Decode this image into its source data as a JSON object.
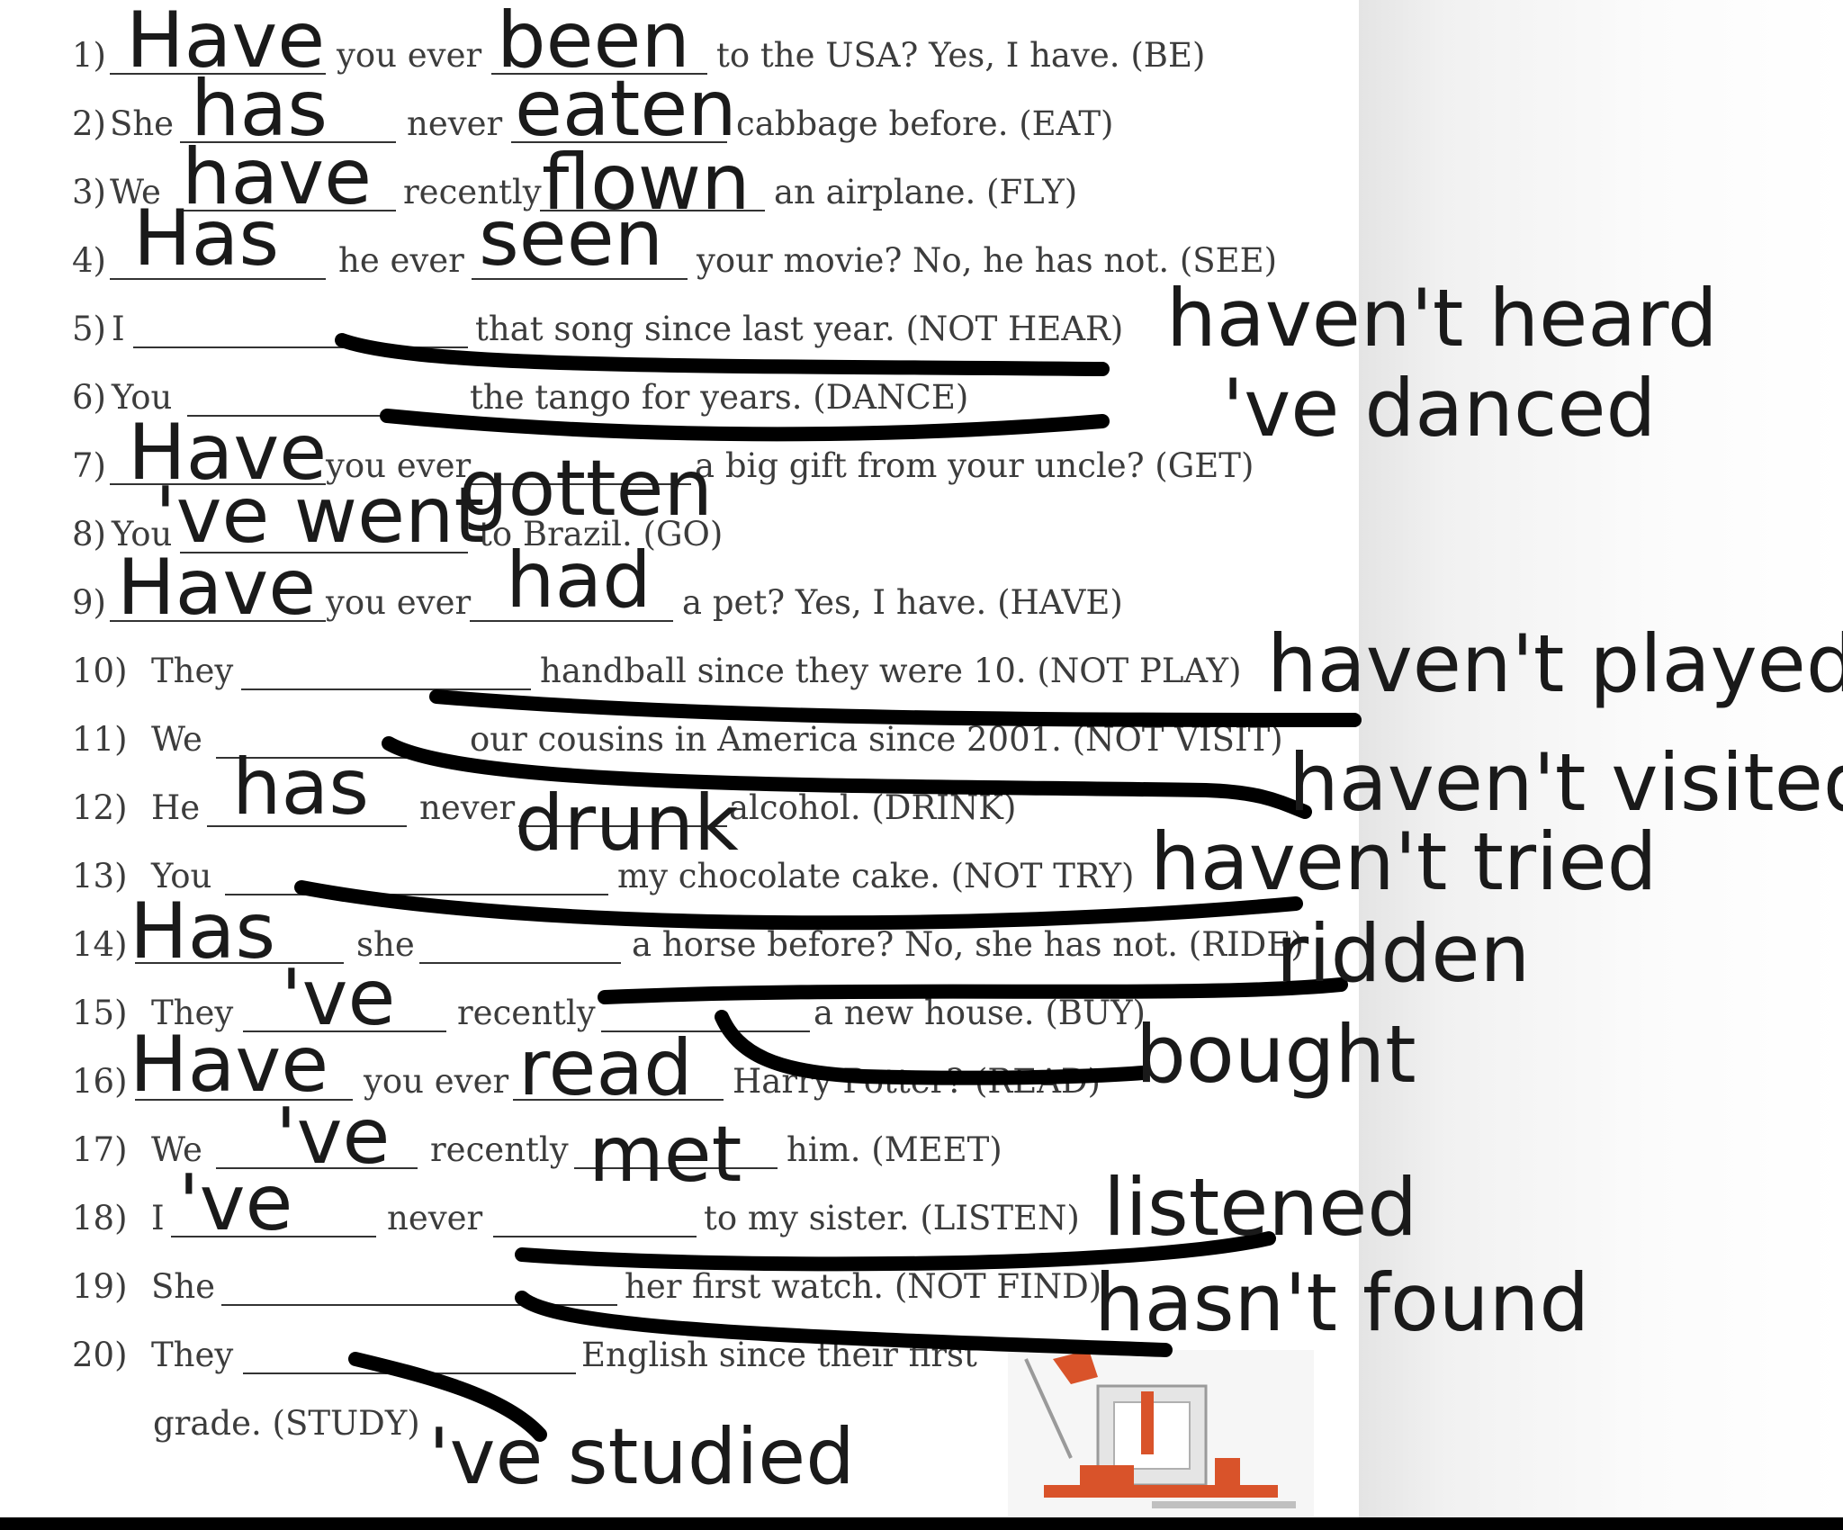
{
  "worksheet": {
    "lines": [
      {
        "n": "1)",
        "texts": [
          "you ever",
          "to the USA? Yes, I have. (BE)"
        ],
        "answers": [
          "Have",
          "been"
        ]
      },
      {
        "n": "2)",
        "texts": [
          "She",
          "never",
          "cabbage before. (EAT)"
        ],
        "answers": [
          "has",
          "eaten"
        ]
      },
      {
        "n": "3)",
        "texts": [
          "We",
          "recently",
          "an airplane. (FLY)"
        ],
        "answers": [
          "have",
          "flown"
        ]
      },
      {
        "n": "4)",
        "texts": [
          "he ever",
          "your movie? No, he has not. (SEE)"
        ],
        "answers": [
          "Has",
          "seen"
        ]
      },
      {
        "n": "5)",
        "texts": [
          "I",
          "that song since last year. (NOT HEAR)"
        ],
        "answers": [
          "haven't heard"
        ]
      },
      {
        "n": "6)",
        "texts": [
          "You",
          "the tango for years. (DANCE)"
        ],
        "answers": [
          "'ve danced"
        ]
      },
      {
        "n": "7)",
        "texts": [
          "you ever",
          "a big gift from your uncle? (GET)"
        ],
        "answers": [
          "Have",
          "gotten"
        ]
      },
      {
        "n": "8)",
        "texts": [
          "You",
          "to Brazil. (GO)"
        ],
        "answers": [
          "'ve went"
        ]
      },
      {
        "n": "9)",
        "texts": [
          "you ever",
          "a pet? Yes, I have. (HAVE)"
        ],
        "answers": [
          "Have",
          "had"
        ]
      },
      {
        "n": "10)",
        "texts": [
          "They",
          "handball since they were 10. (NOT PLAY)"
        ],
        "answers": [
          "haven't played"
        ]
      },
      {
        "n": "11)",
        "texts": [
          "We",
          "our cousins in America since 2001. (NOT VISIT)"
        ],
        "answers": [
          "haven't visited"
        ]
      },
      {
        "n": "12)",
        "texts": [
          "He",
          "never",
          "alcohol. (DRINK)"
        ],
        "answers": [
          "has",
          "drunk"
        ]
      },
      {
        "n": "13)",
        "texts": [
          "You",
          "my chocolate cake. (NOT TRY)"
        ],
        "answers": [
          "haven't tried"
        ]
      },
      {
        "n": "14)",
        "texts": [
          "she",
          "a horse before? No, she has not. (RIDE)"
        ],
        "answers": [
          "Has",
          "ridden"
        ]
      },
      {
        "n": "15)",
        "texts": [
          "They",
          "recently",
          "a new house. (BUY)"
        ],
        "answers": [
          "'ve",
          "bought"
        ]
      },
      {
        "n": "16)",
        "texts": [
          "you ever",
          "Harry Potter? (READ)"
        ],
        "answers": [
          "Have",
          "read"
        ]
      },
      {
        "n": "17)",
        "texts": [
          "We",
          "recently",
          "him. (MEET)"
        ],
        "answers": [
          "'ve",
          "met"
        ]
      },
      {
        "n": "18)",
        "texts": [
          "I",
          "never",
          "to my sister. (LISTEN)"
        ],
        "answers": [
          "'ve",
          "listened"
        ]
      },
      {
        "n": "19)",
        "texts": [
          "She",
          "her first watch. (NOT FIND)"
        ],
        "answers": [
          "hasn't found"
        ]
      },
      {
        "n": "20)",
        "texts": [
          "They",
          "English since their first",
          "grade. (STUDY)"
        ],
        "answers": [
          "'ve studied"
        ]
      }
    ]
  },
  "colors": {
    "ink": "#1a1a1a",
    "print": "#3c3c3c",
    "marker": "#000000",
    "clipart_accent": "#d9532a"
  },
  "icons": {
    "clipart": "books-and-desk-lamp-illustration"
  }
}
